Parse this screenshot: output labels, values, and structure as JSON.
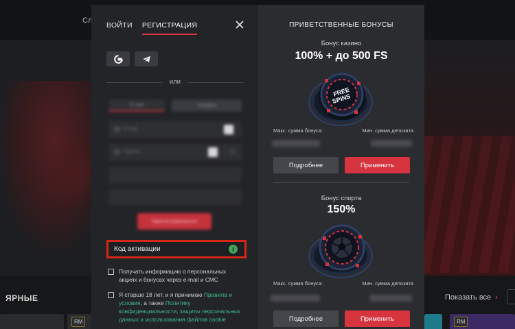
{
  "background": {
    "nav_left": "Сл",
    "section_title": "ЯРНЫЕ",
    "show_all": "Показать все",
    "show_all_arrow": "›",
    "card_tags": [
      "RM",
      "RM"
    ]
  },
  "auth": {
    "tabs": [
      {
        "label": "ВОЙТИ",
        "active": false
      },
      {
        "label": "РЕГИСТРАЦИЯ",
        "active": true
      }
    ],
    "social": [
      {
        "icon": "google-icon"
      },
      {
        "icon": "telegram-icon"
      }
    ],
    "or_label": "или",
    "blurred": {
      "method_tabs": [
        "E-mail",
        "Телефон"
      ],
      "email_label": "E-mail",
      "password_label": "Пароль",
      "submit_label": "Зарегистрироваться"
    },
    "promo_placeholder": "Код активации",
    "promo_info_icon": "info-icon",
    "checkbox_news": "Получать информацию о персональных акциях и бонусах через e-mail и СМС",
    "checkbox_terms": {
      "text_before": "Я старше 18 лет, и я принимаю ",
      "link_rules": "Правила и условия",
      "text_middle": ", а также ",
      "link_privacy": "Политику конфиденциальности, защиты персональных данных и использования файлов cookie"
    }
  },
  "bonuses": {
    "title": "ПРИВЕТСТВЕННЫЕ БОНУСЫ",
    "items": [
      {
        "subtitle": "Бонус казино",
        "amount": "100% + до 500 FS",
        "chip_label": "FREE SPINS",
        "max_label": "Макс. сумма бонуса:",
        "min_label": "Мин. сумма депозита",
        "more_label": "Подробнее",
        "apply_label": "Применить"
      },
      {
        "subtitle": "Бонус спорта",
        "amount": "150%",
        "chip_label": "",
        "max_label": "Макс. сумма бонуса:",
        "min_label": "Мин. сумма депозита",
        "more_label": "Подробнее",
        "apply_label": "Применить"
      }
    ]
  },
  "colors": {
    "accent_red": "#d6343f",
    "highlight_border": "#d62616",
    "link_green": "#3fbf8c",
    "info_green": "#46a35a"
  }
}
